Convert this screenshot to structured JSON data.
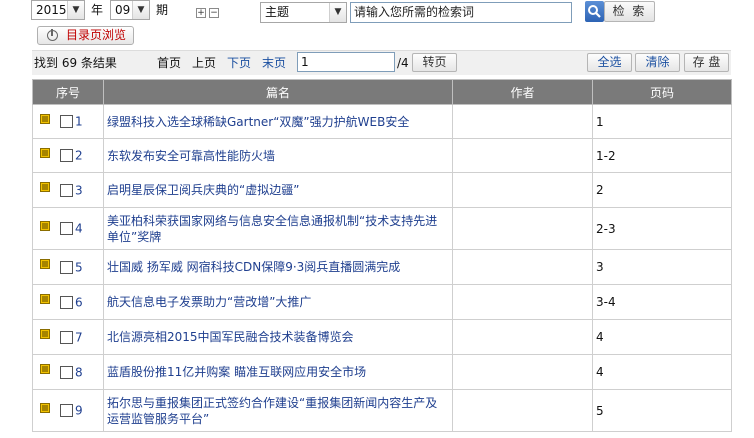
{
  "search": {
    "year_value": "2015",
    "year_label": "年",
    "issue_value": "09",
    "issue_label": "期",
    "field_value": "主题",
    "query_placeholder": "请输入您所需的检索词",
    "search_label": "检 索",
    "expand_glyph": "+",
    "collapse_glyph": "−",
    "dropdown_glyph": "▼"
  },
  "catalog_button_label": "目录页浏览",
  "results": {
    "found_label": "找到 69 条结果",
    "first_page": "首页",
    "prev_page": "上页",
    "next_page": "下页",
    "last_page": "末页",
    "current_page": "1",
    "total_pages": "/4",
    "goto_label": "转页",
    "select_all": "全选",
    "clear": "清除",
    "save": "存 盘"
  },
  "table": {
    "headers": {
      "no": "序号",
      "title": "篇名",
      "author": "作者",
      "pages": "页码"
    },
    "rows": [
      {
        "no": "1",
        "title": "绿盟科技入选全球稀缺Gartner“双魔”强力护航WEB安全",
        "author": "",
        "pages": "1"
      },
      {
        "no": "2",
        "title": "东软发布安全可靠高性能防火墙",
        "author": "",
        "pages": "1-2"
      },
      {
        "no": "3",
        "title": "启明星辰保卫阅兵庆典的“虚拟边疆”",
        "author": "",
        "pages": "2"
      },
      {
        "no": "4",
        "title": "美亚柏科荣获国家网络与信息安全信息通报机制“技术支持先进单位”奖牌",
        "author": "",
        "pages": "2-3"
      },
      {
        "no": "5",
        "title": "壮国威 扬军威 网宿科技CDN保障9·3阅兵直播圆满完成",
        "author": "",
        "pages": "3"
      },
      {
        "no": "6",
        "title": "航天信息电子发票助力“营改增”大推广",
        "author": "",
        "pages": "3-4"
      },
      {
        "no": "7",
        "title": "北信源亮相2015中国军民融合技术装备博览会",
        "author": "",
        "pages": "4"
      },
      {
        "no": "8",
        "title": "蓝盾股份推11亿并购案 瞄准互联网应用安全市场",
        "author": "",
        "pages": "4"
      },
      {
        "no": "9",
        "title": "拓尔思与重报集团正式签约合作建设“重报集团新闻内容生产及运营监管服务平台”",
        "author": "",
        "pages": "5"
      }
    ]
  },
  "icons": {
    "doc": "document-icon",
    "search": "search-icon",
    "catalog": "catalog-icon"
  },
  "colors": {
    "header_bg": "#7a7a7a",
    "link": "#1f3f8f",
    "catalog_text": "#c00000",
    "doc_icon": "#f2c200"
  }
}
